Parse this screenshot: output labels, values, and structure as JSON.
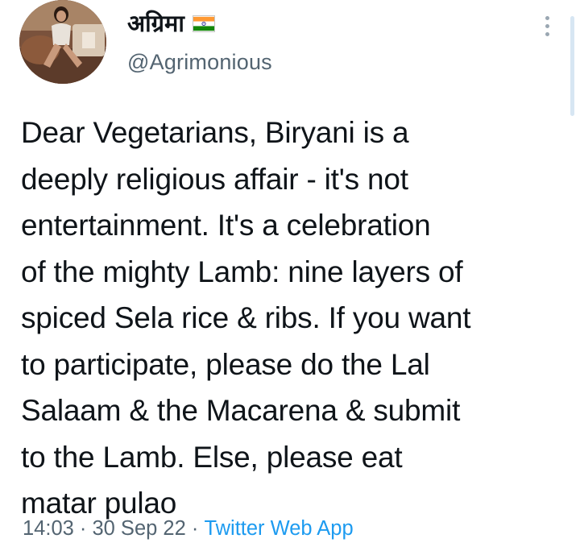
{
  "tweet": {
    "display_name": "अग्रिमा",
    "flag_icon": "india-flag-icon",
    "handle": "@Agrimonious",
    "more_icon": "more-vertical-icon",
    "text": "Dear Vegetarians, Biryani is a\ndeeply religious affair - it's not\nentertainment. It's a celebration\nof the mighty Lamb: nine layers of\nspiced Sela rice & ribs. If you want\nto participate, please do the Lal\nSalaam & the Macarena & submit\nto the Lamb. Else, please eat\nmatar pulao",
    "time": "14:03",
    "date": "30 Sep 22",
    "source": "Twitter Web App",
    "separator": " · "
  },
  "colors": {
    "text": "#0f1419",
    "muted": "#536471",
    "link": "#1d9bf0",
    "saffron": "#ff9933",
    "green": "#138808",
    "chakra": "#000080"
  }
}
